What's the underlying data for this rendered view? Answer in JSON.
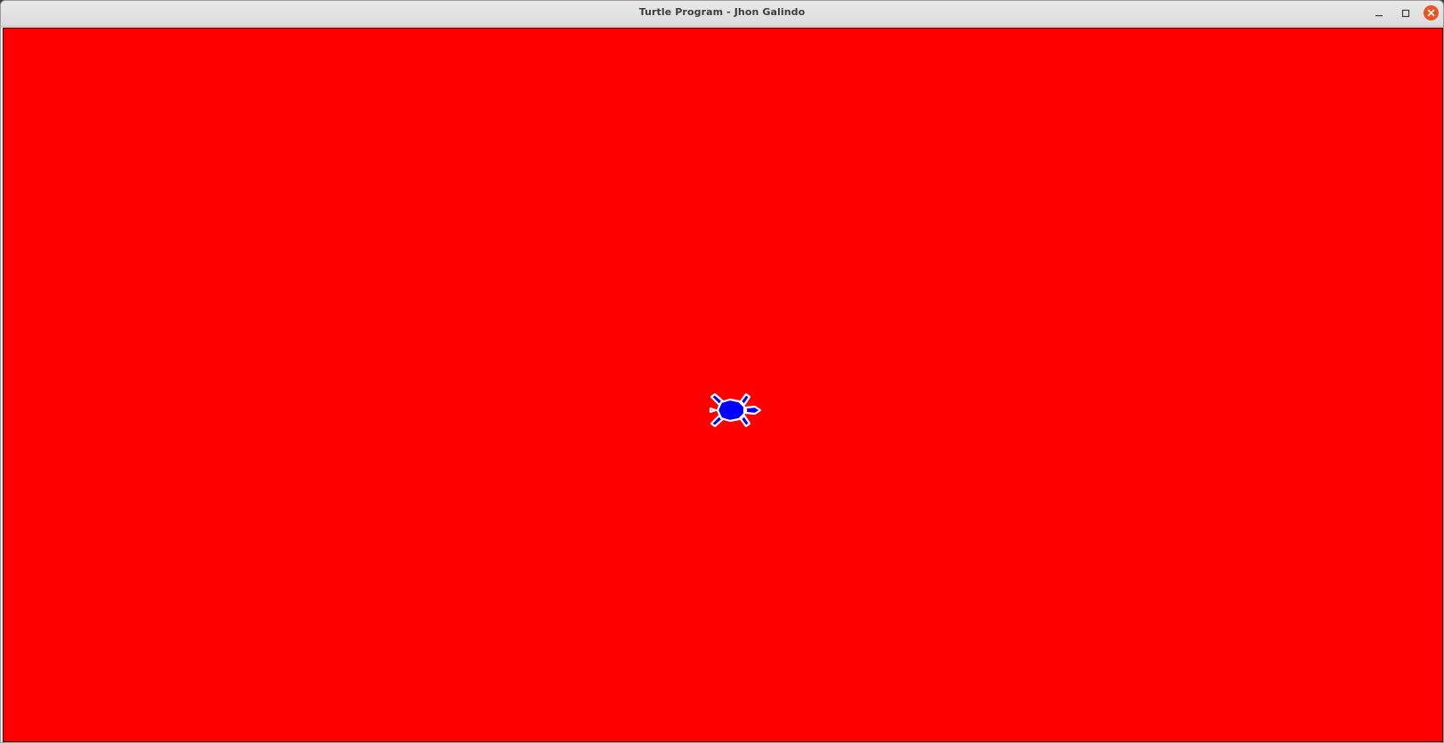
{
  "window": {
    "title": "Turtle Program - Jhon Galindo",
    "controls": {
      "minimize_icon": "minimize-icon",
      "maximize_icon": "maximize-icon",
      "close_icon": "close-icon"
    },
    "close_color": "#e95420"
  },
  "canvas": {
    "background_color": "#ff0000",
    "turtle": {
      "icon": "turtle-icon",
      "fill_color": "#0000ff",
      "outline_color": "#ffffff",
      "heading": "east"
    }
  }
}
